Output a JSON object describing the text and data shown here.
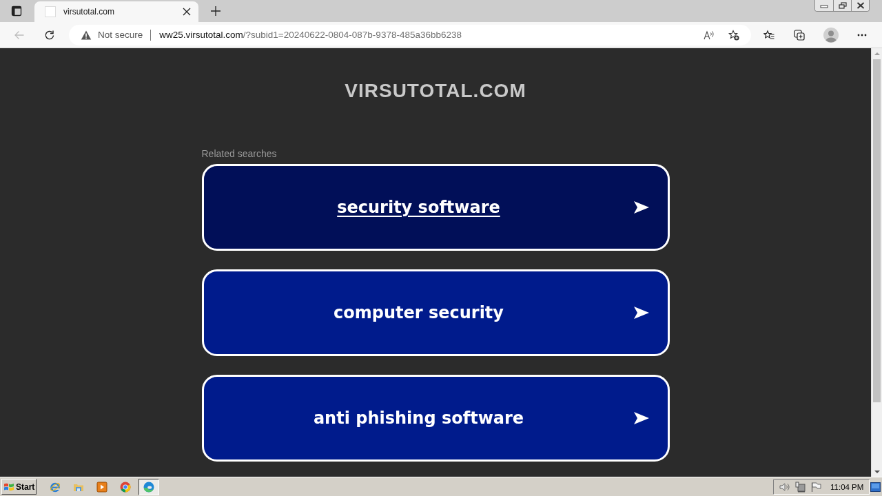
{
  "browser": {
    "tab": {
      "title": "virsutotal.com"
    },
    "back_button": {
      "disabled": true
    },
    "address_bar": {
      "security_label": "Not secure",
      "url_host": "ww25.virsutotal.com",
      "url_path": "/?subid1=20240622-0804-087b-9378-485a36bb6238"
    }
  },
  "page": {
    "site_title": "VIRSUTOTAL.COM",
    "section_label": "Related searches",
    "links": [
      {
        "label": "security software",
        "hovered": true
      },
      {
        "label": "computer security",
        "hovered": false
      },
      {
        "label": "anti phishing software",
        "hovered": false
      }
    ]
  },
  "taskbar": {
    "start_label": "Start",
    "apps": [
      {
        "kind": "ie",
        "selected": false
      },
      {
        "kind": "explorer",
        "selected": false
      },
      {
        "kind": "media",
        "selected": false
      },
      {
        "kind": "chrome",
        "selected": false
      },
      {
        "kind": "edge",
        "selected": true
      }
    ],
    "clock": "11:04 PM"
  }
}
